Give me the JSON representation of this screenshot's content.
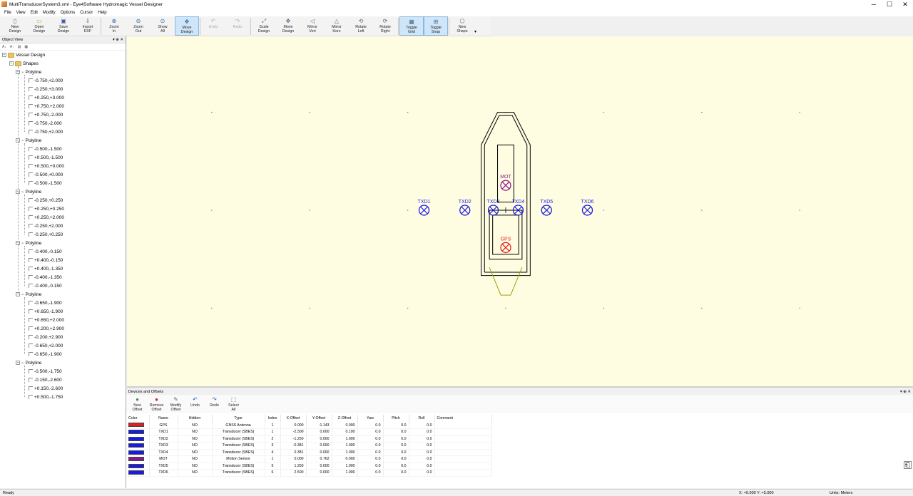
{
  "window": {
    "title": "MultiTransducerSystem3.xml - Eye4Software Hydromagic Vessel Designer",
    "minimize_glyph": "─",
    "maximize_glyph": "☐",
    "close_glyph": "✕"
  },
  "menu": [
    "File",
    "View",
    "Edit",
    "Modify",
    "Options",
    "Cursor",
    "Help"
  ],
  "toolbar": [
    {
      "line1": "New",
      "line2": "Design",
      "icon": "new-document-icon"
    },
    {
      "line1": "Open",
      "line2": "Design",
      "icon": "open-folder-icon"
    },
    {
      "line1": "Save",
      "line2": "Design",
      "icon": "floppy-disk-icon"
    },
    {
      "line1": "Import",
      "line2": "DXF",
      "icon": "import-icon"
    },
    {
      "line1": "Zoom",
      "line2": "In",
      "icon": "zoom-in-icon"
    },
    {
      "line1": "Zoom",
      "line2": "Out",
      "icon": "zoom-out-icon"
    },
    {
      "line1": "Show",
      "line2": "All",
      "icon": "zoom-all-icon"
    },
    {
      "line1": "Move",
      "line2": "Design",
      "icon": "move-icon"
    },
    {
      "line1": "Undo",
      "line2": "",
      "icon": "undo-icon"
    },
    {
      "line1": "Redo",
      "line2": "",
      "icon": "redo-icon"
    },
    {
      "line1": "Scale",
      "line2": "Design",
      "icon": "scale-icon"
    },
    {
      "line1": "Move",
      "line2": "Design",
      "icon": "move-design-icon"
    },
    {
      "line1": "Mirror",
      "line2": "Vert",
      "icon": "mirror-vertical-icon"
    },
    {
      "line1": "Mirror",
      "line2": "Horz",
      "icon": "mirror-horizontal-icon"
    },
    {
      "line1": "Rotate",
      "line2": "Left",
      "icon": "rotate-left-icon"
    },
    {
      "line1": "Rotate",
      "line2": "Right",
      "icon": "rotate-right-icon"
    },
    {
      "line1": "Toggle",
      "line2": "Grid",
      "icon": "grid-icon"
    },
    {
      "line1": "Toggle",
      "line2": "Snap",
      "icon": "snap-icon"
    },
    {
      "line1": "New",
      "line2": "Shape",
      "icon": "new-shape-icon"
    }
  ],
  "object_view": {
    "title": "Object View",
    "root": "Vessel Design",
    "shapes_label": "Shapes",
    "polylines": [
      {
        "label": "Polyline",
        "points": [
          "-0.750,+2.000",
          "-0.250,+3.000",
          "+0.250,+3.000",
          "+0.750,+2.000",
          "+0.750,-2.000",
          "-0.750,-2.000",
          "-0.750,+2.000"
        ]
      },
      {
        "label": "Polyline",
        "points": [
          "-0.500,-1.500",
          "+0.500,-1.500",
          "+0.500,+0.000",
          "-0.500,+0.000",
          "-0.500,-1.500"
        ]
      },
      {
        "label": "Polyline",
        "points": [
          "-0.250,+0.250",
          "+0.250,+0.250",
          "+0.250,+2.000",
          "-0.250,+2.000",
          "-0.250,+0.250"
        ]
      },
      {
        "label": "Polyline",
        "points": [
          "-0.400,-0.150",
          "+0.400,-0.150",
          "+0.400,-1.350",
          "-0.400,-1.350",
          "-0.400,-0.150"
        ]
      },
      {
        "label": "Polyline",
        "points": [
          "-0.650,-1.900",
          "+0.650,-1.900",
          "+0.650,+2.000",
          "+0.200,+2.900",
          "-0.200,+2.900",
          "-0.650,+2.000",
          "-0.650,-1.900"
        ]
      },
      {
        "label": "Polyline",
        "points": [
          "-0.500,-1.750",
          "-0.150,-2.600",
          "+0.150,-2.600",
          "+0.500,-1.750"
        ]
      }
    ]
  },
  "devices_panel": {
    "title": "Devices and Offsets",
    "toolbar": [
      {
        "line1": "New",
        "line2": "Offset",
        "icon": "add-green-icon"
      },
      {
        "line1": "Remove",
        "line2": "Offset",
        "icon": "remove-red-icon"
      },
      {
        "line1": "Modify",
        "line2": "Offset",
        "icon": "modify-icon"
      },
      {
        "line1": "Undo",
        "line2": "",
        "icon": "undo-icon"
      },
      {
        "line1": "Redo",
        "line2": "",
        "icon": "redo-icon"
      },
      {
        "line1": "Select",
        "line2": "All",
        "icon": "select-all-icon"
      }
    ],
    "columns": [
      "Color",
      "Name",
      "Hidden",
      "Type",
      "Index",
      "X-Offset",
      "Y-Offset",
      "Z-Offset",
      "Yaw",
      "Pitch",
      "Roll",
      "Comment"
    ],
    "rows": [
      {
        "color": "#e02020",
        "name": "GPS",
        "hidden": "NO",
        "type": "GNSS Antenna",
        "index": "1",
        "x": "0.000",
        "y": "-1.143",
        "z": "0.000",
        "yaw": "0.0",
        "pitch": "0.0",
        "roll": "0.0",
        "comment": ""
      },
      {
        "color": "#1a1ae6",
        "name": "TXD1",
        "hidden": "NO",
        "type": "Transducer (SBES)",
        "index": "1",
        "x": "-2.500",
        "y": "0.000",
        "z": "0.100",
        "yaw": "0.0",
        "pitch": "0.0",
        "roll": "0.0",
        "comment": ""
      },
      {
        "color": "#1a1ae6",
        "name": "TXD2",
        "hidden": "NO",
        "type": "Transducer (SBES)",
        "index": "2",
        "x": "-1.250",
        "y": "0.000",
        "z": "1.000",
        "yaw": "0.0",
        "pitch": "0.0",
        "roll": "0.0",
        "comment": ""
      },
      {
        "color": "#1a1ae6",
        "name": "TXD3",
        "hidden": "NO",
        "type": "Transducer (SBES)",
        "index": "3",
        "x": "-0.381",
        "y": "0.000",
        "z": "1.000",
        "yaw": "0.0",
        "pitch": "0.0",
        "roll": "0.0",
        "comment": ""
      },
      {
        "color": "#1a1ae6",
        "name": "TXD4",
        "hidden": "NO",
        "type": "Transducer (SBES)",
        "index": "4",
        "x": "0.381",
        "y": "0.000",
        "z": "1.000",
        "yaw": "0.0",
        "pitch": "0.0",
        "roll": "0.0",
        "comment": ""
      },
      {
        "color": "#8a1a8a",
        "name": "MOT",
        "hidden": "NO",
        "type": "Motion Sensor",
        "index": "1",
        "x": "0.000",
        "y": "0.762",
        "z": "0.000",
        "yaw": "0.0",
        "pitch": "0.0",
        "roll": "0.0",
        "comment": ""
      },
      {
        "color": "#1a1ae6",
        "name": "TXD5",
        "hidden": "NO",
        "type": "Transducer (SBES)",
        "index": "5",
        "x": "1.250",
        "y": "0.000",
        "z": "1.000",
        "yaw": "0.0",
        "pitch": "0.0",
        "roll": "0.0",
        "comment": ""
      },
      {
        "color": "#1a1ae6",
        "name": "TXD6",
        "hidden": "NO",
        "type": "Transducer (SBES)",
        "index": "6",
        "x": "2.500",
        "y": "0.000",
        "z": "1.000",
        "yaw": "0.0",
        "pitch": "0.0",
        "roll": "0.0",
        "comment": ""
      }
    ]
  },
  "status": {
    "left": "Ready",
    "coords": "X: +0.000 Y: +5.000",
    "units": "Units: Meters"
  },
  "colors": {
    "canvas_bg": "#fffde1",
    "hull_stroke": "#000000",
    "transom_stroke": "#a0a000",
    "grid_dot": "#8a8a70"
  }
}
